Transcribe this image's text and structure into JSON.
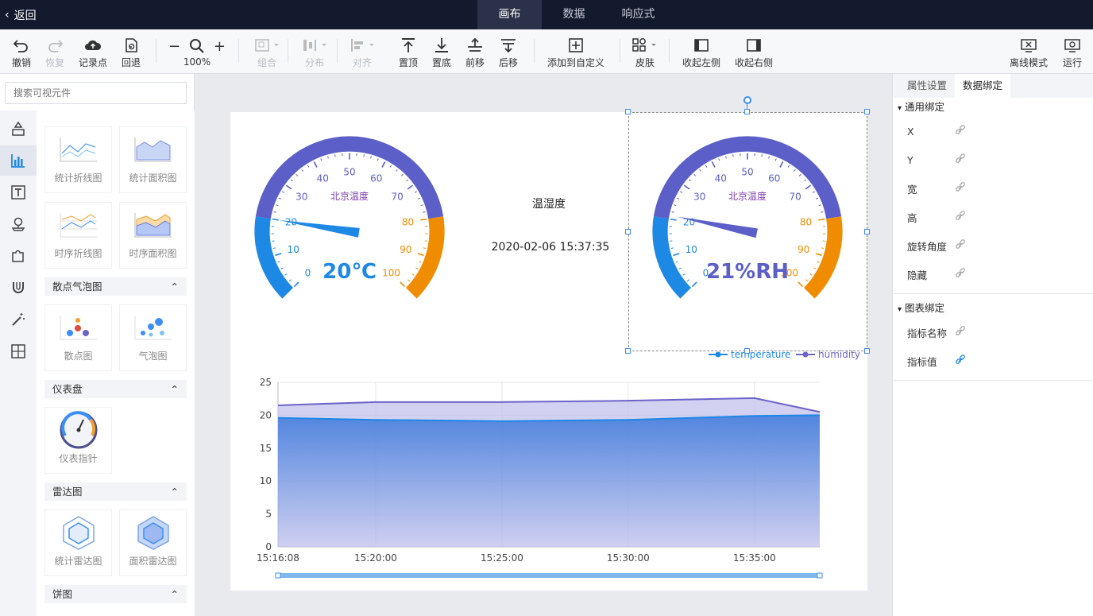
{
  "topbar": {
    "back_label": "返回",
    "tabs": [
      "画布",
      "数据",
      "响应式"
    ],
    "active_tab": 0
  },
  "toolbar": {
    "undo": "撤销",
    "redo": "恢复",
    "record": "记录点",
    "rollback": "回退",
    "zoom": "100%",
    "group": "组合",
    "distribute": "分布",
    "align": "对齐",
    "to_top": "置顶",
    "to_bottom": "置底",
    "forward": "前移",
    "backward": "后移",
    "add_custom": "添加到自定义",
    "skin": "皮肤",
    "collapse_left": "收起左侧",
    "collapse_right": "收起右侧",
    "offline": "离线模式",
    "run": "运行"
  },
  "left": {
    "search_placeholder": "搜索可视元件",
    "cards": [
      "统计折线图",
      "统计面积图",
      "时序折线图",
      "时序面积图",
      "散点图",
      "气泡图",
      "仪表指针",
      "统计雷达图",
      "面积雷达图"
    ],
    "sections": [
      "散点气泡图",
      "仪表盘",
      "雷达图",
      "饼图"
    ]
  },
  "canvas": {
    "gauge1": {
      "title": "北京温度",
      "value_text": "20℃",
      "value": 20,
      "ticks": [
        "0",
        "10",
        "20",
        "30",
        "40",
        "50",
        "60",
        "70",
        "80",
        "90",
        "100"
      ]
    },
    "gauge2": {
      "title": "北京温度",
      "value_text": "21%RH",
      "value": 21,
      "ticks": [
        "0",
        "10",
        "20",
        "30",
        "40",
        "50",
        "60",
        "70",
        "80",
        "90",
        "100"
      ]
    },
    "title": "温湿度",
    "datetime": "2020-02-06 15:37:35"
  },
  "chart_data": {
    "type": "area",
    "x": [
      "15:16:08",
      "15:20:00",
      "15:25:00",
      "15:30:00",
      "15:35:00",
      "15:37:35"
    ],
    "xticks": [
      "15:16:08",
      "15:20:00",
      "15:25:00",
      "15:30:00",
      "15:35:00"
    ],
    "yticks": [
      "0",
      "5",
      "10",
      "15",
      "20",
      "25"
    ],
    "ylim": [
      0,
      25
    ],
    "legend": "top-right",
    "series": [
      {
        "name": "temperature",
        "values": [
          19.6,
          19.3,
          19.1,
          19.3,
          19.9,
          20.0
        ],
        "color": "#1e88e5"
      },
      {
        "name": "humidity",
        "values": [
          21.5,
          22.0,
          22.0,
          22.2,
          22.6,
          20.5
        ],
        "color": "#6c63c8"
      }
    ]
  },
  "right": {
    "tabs": [
      "属性设置",
      "数据绑定"
    ],
    "general_title": "通用绑定",
    "general_rows": [
      "X",
      "Y",
      "宽",
      "高",
      "旋转角度",
      "隐藏"
    ],
    "chart_title": "图表绑定",
    "chart_rows": [
      "指标名称",
      "指标值"
    ]
  },
  "colors": {
    "topbar": "#131a2e",
    "accent": "#1e88e5",
    "humidity": "#6c63c8",
    "orange": "#f08c00",
    "gauge_blue": "#5b5fc7"
  }
}
